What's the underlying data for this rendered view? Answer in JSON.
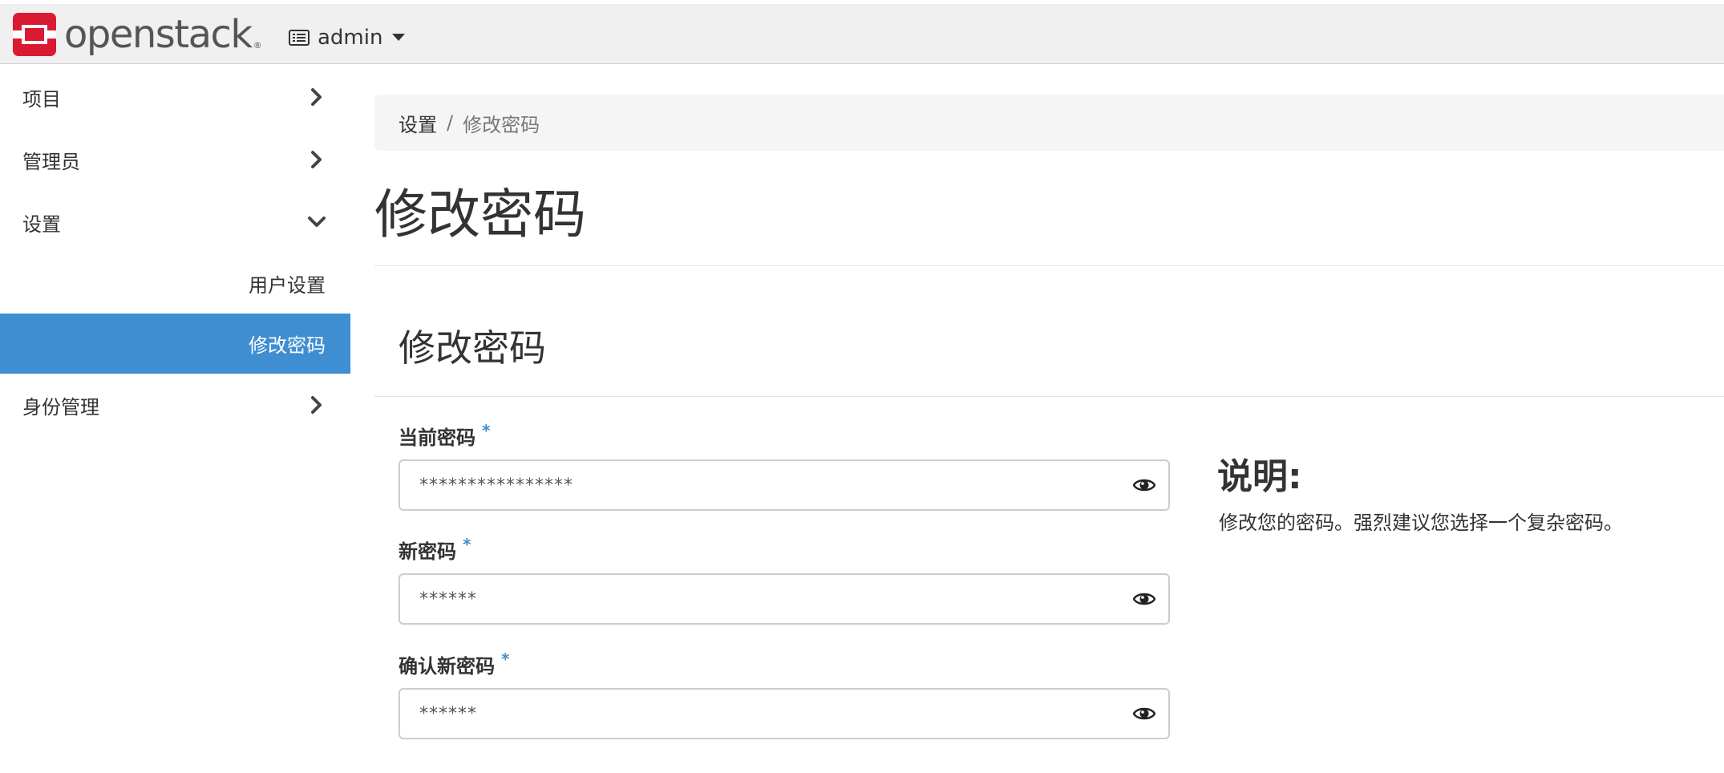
{
  "brand": {
    "name": "openstack",
    "registered": "®",
    "colors": {
      "logo_red": "#da1a32",
      "active": "#3f8ed1",
      "required": "#3f8ed1"
    }
  },
  "header": {
    "project_selector": {
      "label": "admin",
      "icon": "list-icon",
      "caret": "caret-down-icon"
    }
  },
  "sidebar": {
    "items": [
      {
        "label": "项目",
        "icon": "chevron-right-icon",
        "expanded": false
      },
      {
        "label": "管理员",
        "icon": "chevron-right-icon",
        "expanded": false
      },
      {
        "label": "设置",
        "icon": "chevron-down-icon",
        "expanded": true,
        "children": [
          {
            "label": "用户设置",
            "active": false
          },
          {
            "label": "修改密码",
            "active": true
          }
        ]
      },
      {
        "label": "身份管理",
        "icon": "chevron-right-icon",
        "expanded": false
      }
    ]
  },
  "breadcrumb": {
    "items": [
      "设置",
      "修改密码"
    ],
    "separator": "/"
  },
  "page": {
    "title": "修改密码"
  },
  "form": {
    "title": "修改密码",
    "fields": [
      {
        "label": "当前密码",
        "required": "*",
        "value": "****************"
      },
      {
        "label": "新密码",
        "required": "*",
        "value": "******"
      },
      {
        "label": "确认新密码",
        "required": "*",
        "value": "******"
      }
    ],
    "toggle_icon": "eye-icon"
  },
  "help": {
    "title": "说明:",
    "text": "修改您的密码。强烈建议您选择一个复杂密码。"
  }
}
